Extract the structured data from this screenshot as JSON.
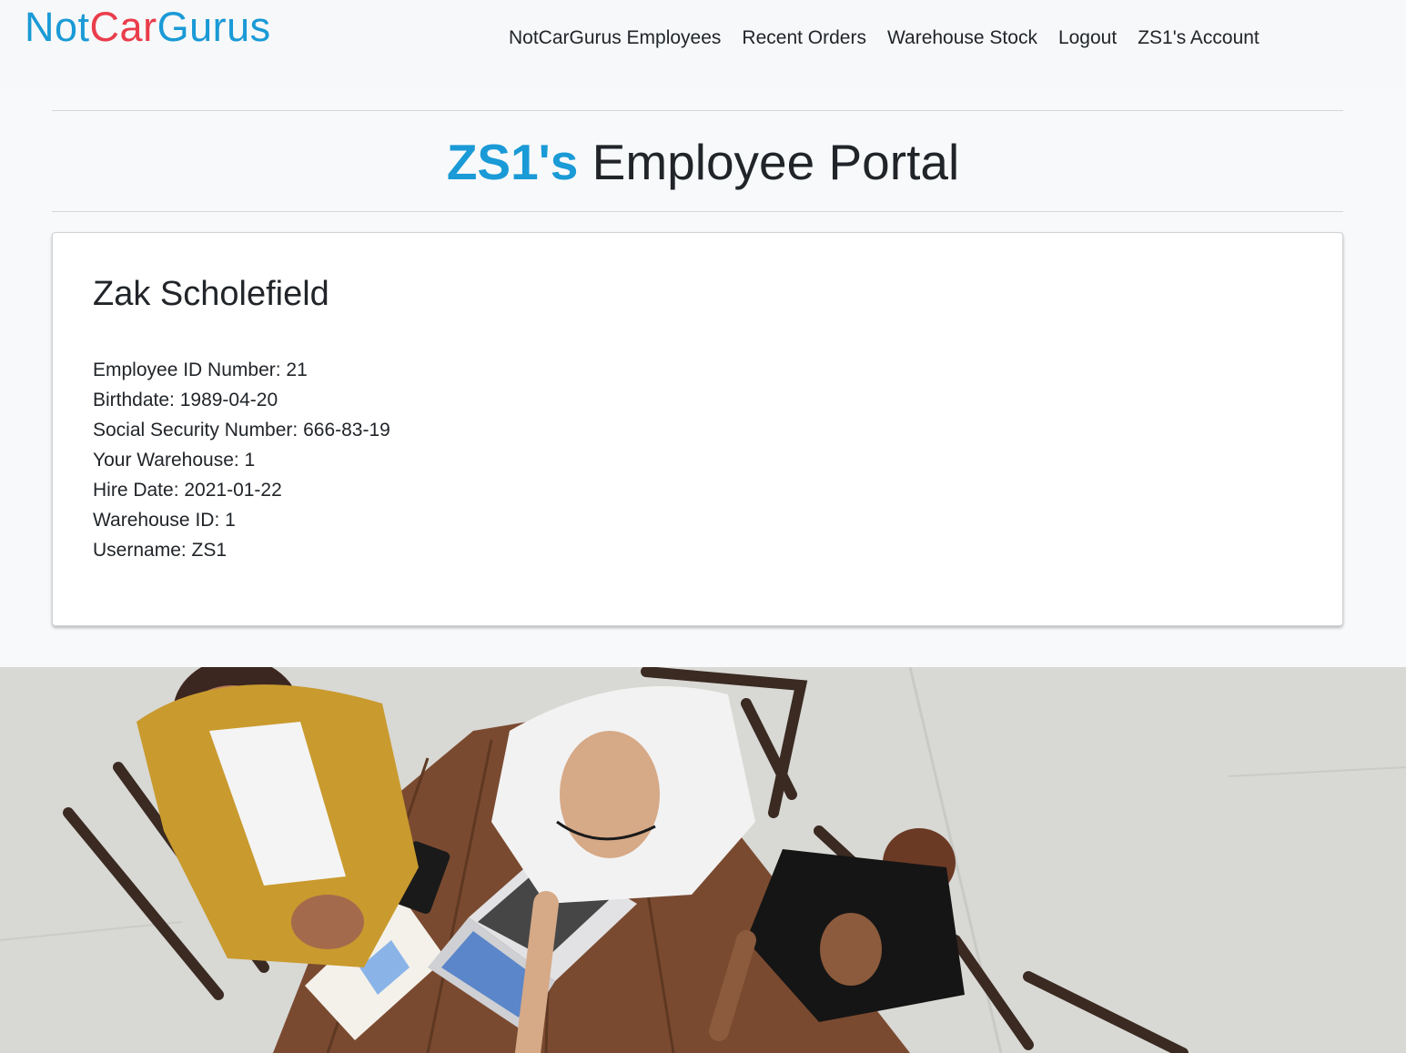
{
  "brand": {
    "logo_part1": "N",
    "logo_o1": "o",
    "logo_part2": "t",
    "logo_part3": "Car",
    "logo_part4": "Gurus"
  },
  "nav": {
    "items": [
      {
        "label": "NotCarGurus Employees"
      },
      {
        "label": "Recent Orders"
      },
      {
        "label": "Warehouse Stock"
      },
      {
        "label": "Logout"
      },
      {
        "label": "ZS1's Account"
      }
    ]
  },
  "header": {
    "highlight": "ZS1's",
    "title_rest": " Employee Portal"
  },
  "profile": {
    "name": "Zak Scholefield",
    "fields": [
      "Employee ID Number: 21",
      "Birthdate: 1989-04-20",
      "Social Security Number: 666-83-19",
      "Your Warehouse: 1",
      "Hire Date: 2021-01-22",
      "Warehouse ID: 1",
      "Username: ZS1"
    ]
  },
  "colors": {
    "accent": "#1a9ad6",
    "logo_red": "#ea3d4c"
  }
}
